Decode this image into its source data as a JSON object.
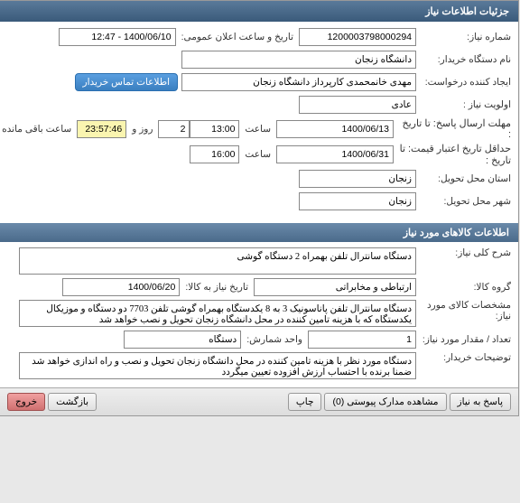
{
  "titlebar": "جزئیات اطلاعات نیاز",
  "section1": {
    "need_no_label": "شماره نیاز:",
    "need_no": "1200003798000294",
    "announce_label": "تاریخ و ساعت اعلان عمومی:",
    "announce_value": "1400/06/10 - 12:47",
    "buyer_name_label": "نام دستگاه خریدار:",
    "buyer_name": "دانشگاه زنجان",
    "requester_label": "ایجاد کننده درخواست:",
    "requester": "مهدی خانمحمدی کارپرداز دانشگاه زنجان",
    "contact_btn": "اطلاعات تماس خریدار",
    "priority_label": "اولویت نیاز :",
    "priority_value": "عادی",
    "reply_deadline_label": "مهلت ارسال پاسخ:",
    "until_label": "تا تاریخ :",
    "reply_date": "1400/06/13",
    "time_label": "ساعت",
    "reply_time": "13:00",
    "days_count": "2",
    "days_label": "روز و",
    "countdown": "23:57:46",
    "remaining_label": "ساعت باقی مانده",
    "price_deadline_label": "حداقل تاریخ اعتبار قیمت:",
    "price_date": "1400/06/31",
    "price_time": "16:00",
    "province_label": "استان محل تحویل:",
    "province": "زنجان",
    "city_label": "شهر محل تحویل:",
    "city": "زنجان"
  },
  "section2": {
    "header": "اطلاعات کالاهای مورد نیاز",
    "desc_label": "شرح کلی نیاز:",
    "desc": "دستگاه سانترال تلفن بهمراه 2 دستگاه گوشی",
    "group_label": "گروه کالا:",
    "group": "ارتباطی و مخابراتی",
    "deliver_date_label": "تاریخ نیاز به کالا:",
    "deliver_date": "1400/06/20",
    "spec_label": "مشخصات کالای مورد نیاز:",
    "spec": "دستگاه سانترال تلفن پاناسونیک 3 به 8 یکدستگاه بهمراه گوشی تلفن 7703 دو دستگاه و موزیکال یکدستگاه که با هزینه تامین کننده در محل دانشگاه زنجان تحویل و نصب خواهد شد",
    "qty_label": "تعداد / مقدار مورد نیاز:",
    "qty": "1",
    "unit_label": "واحد شمارش:",
    "unit": "دستگاه",
    "notes_label": "توضیحات خریدار:",
    "notes": "دستگاه مورد نظر با هزینه تامین کننده در محل دانشگاه زنجان تحویل و نصب و راه اندازی خواهد شد ضمنا برنده با احتساب ارزش افزوده تعیین میگردد"
  },
  "footer": {
    "reply": "پاسخ به نیاز",
    "attach": "مشاهده مدارک پیوستی (0)",
    "print": "چاپ",
    "back": "بازگشت",
    "exit": "خروج"
  }
}
